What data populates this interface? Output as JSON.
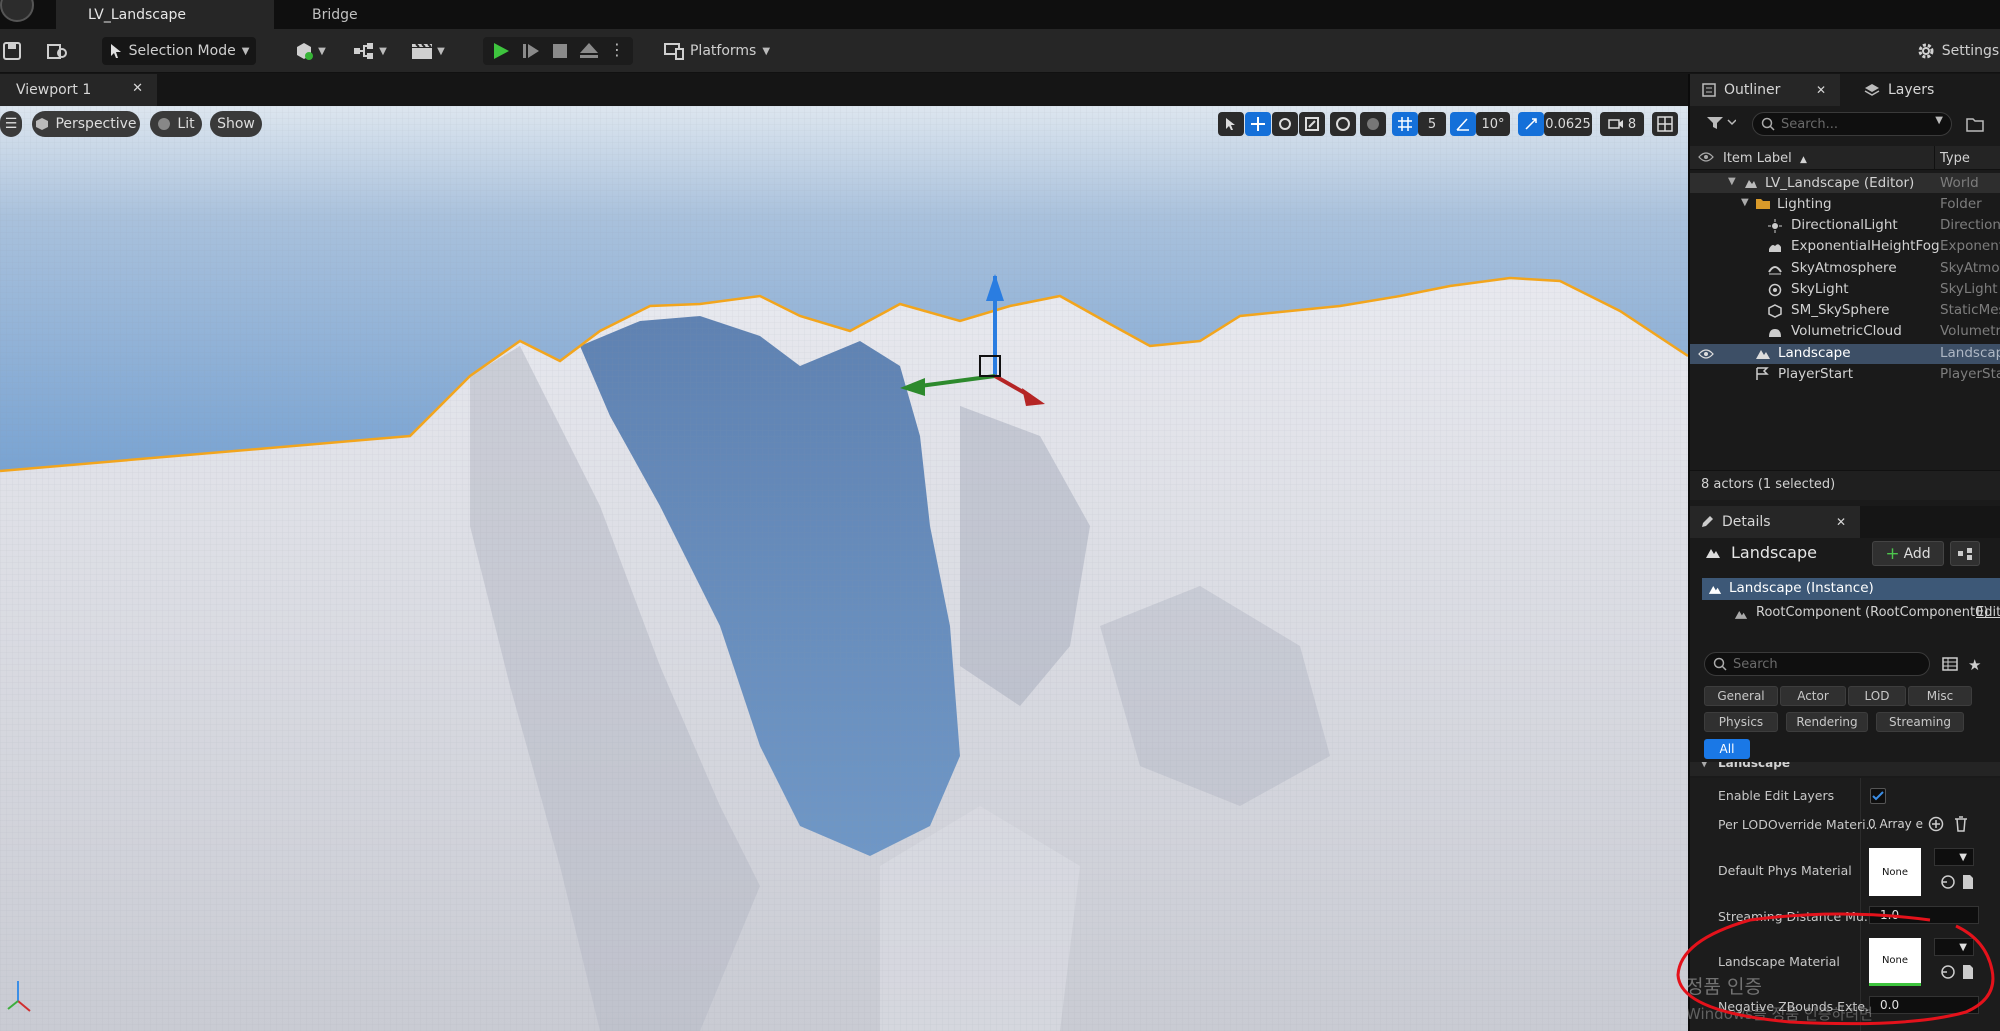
{
  "tabs": {
    "level": "LV_Landscape",
    "bridge": "Bridge"
  },
  "toolbar": {
    "selection_mode": "Selection Mode",
    "platforms": "Platforms",
    "settings": "Settings"
  },
  "viewport": {
    "tab_label": "Viewport 1",
    "perspective": "Perspective",
    "lit": "Lit",
    "show": "Show",
    "grid_snap": "5",
    "rotation_snap": "10°",
    "scale_snap": "0.0625",
    "camera_speed": "8"
  },
  "outliner": {
    "tab": "Outliner",
    "layers_tab": "Layers",
    "search_placeholder": "Search...",
    "col_label": "Item Label",
    "col_type": "Type",
    "items": [
      {
        "label": "LV_Landscape (Editor)",
        "type": "World"
      },
      {
        "label": "Lighting",
        "type": "Folder"
      },
      {
        "label": "DirectionalLight",
        "type": "Directiona"
      },
      {
        "label": "ExponentialHeightFog",
        "type": "Exponent"
      },
      {
        "label": "SkyAtmosphere",
        "type": "SkyAtmos"
      },
      {
        "label": "SkyLight",
        "type": "SkyLight"
      },
      {
        "label": "SM_SkySphere",
        "type": "StaticMes"
      },
      {
        "label": "VolumetricCloud",
        "type": "Volumetri"
      },
      {
        "label": "Landscape",
        "type": "Landscap"
      },
      {
        "label": "PlayerStart",
        "type": "PlayerSta"
      }
    ],
    "status": "8 actors (1 selected)"
  },
  "details": {
    "tab": "Details",
    "title": "Landscape",
    "add": "Add",
    "instance": "Landscape (Instance)",
    "root_component": "RootComponent (RootComponent0)",
    "edit": "Edit",
    "search_placeholder": "Search",
    "categories": [
      "General",
      "Actor",
      "LOD",
      "Misc",
      "Physics",
      "Rendering",
      "Streaming",
      "All"
    ],
    "section": "Landscape",
    "props": {
      "enable_edit_layers": "Enable Edit Layers",
      "per_lod": "Per LODOverride Materi...",
      "per_lod_value": "0 Array e",
      "default_phys": "Default Phys Material",
      "none": "None",
      "streaming": "Streaming Distance Mu...",
      "streaming_value": "1.0",
      "landscape_material": "Landscape Material",
      "negative_z": "Negative ZBounds Exte...",
      "negative_z_value": "0.0"
    }
  },
  "watermark": {
    "line1": "정품 인증",
    "line2": "Windows를 정품 인증하려면"
  },
  "colors": {
    "accent": "#1a78e6",
    "selection_outline": "#f2a51d",
    "annotation": "#e4121b"
  }
}
